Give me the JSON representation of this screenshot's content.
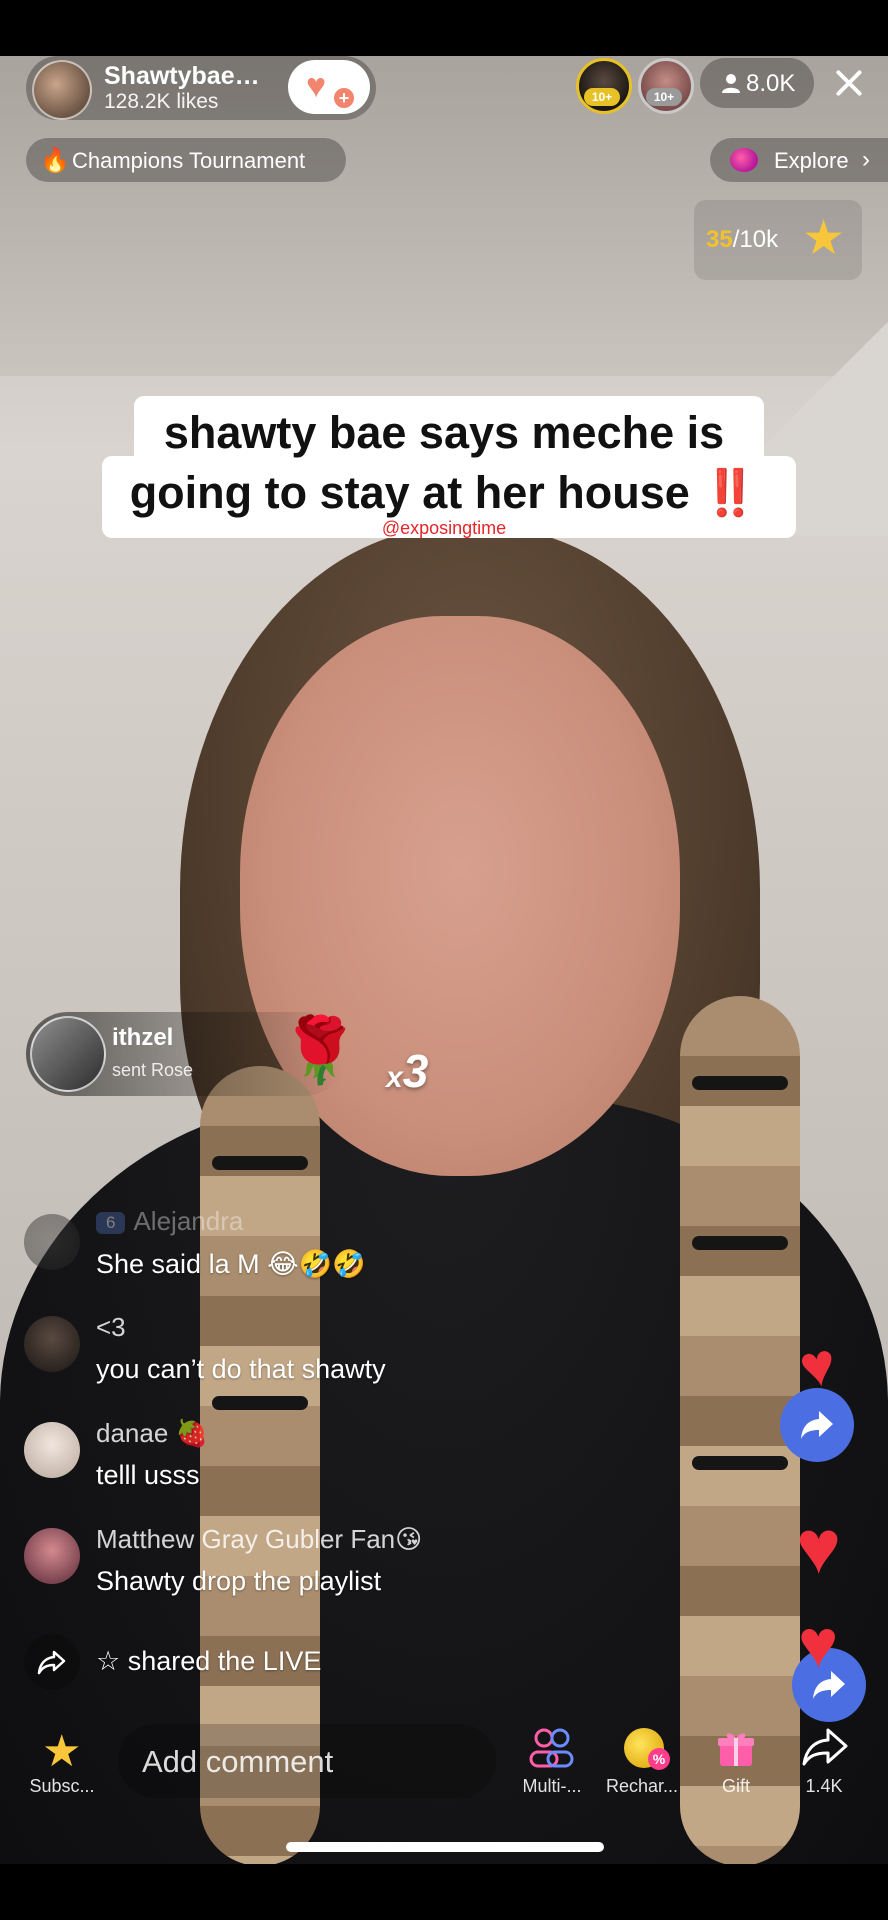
{
  "host": {
    "name": "Shawtybae…",
    "likes": "128.2K likes"
  },
  "viewers": {
    "badge_1": "10+",
    "badge_2": "10+",
    "count": "8.0K"
  },
  "tournament": {
    "label": "Champions Tournament"
  },
  "explore": {
    "label": "Explore",
    "chevron": "›"
  },
  "goal": {
    "current": "35",
    "target": "/10k"
  },
  "caption": {
    "line1": "shawty bae says meche is",
    "line2": "going to stay at her house",
    "emoji": "‼️",
    "watermark": "@exposingtime"
  },
  "gift_toast": {
    "user": "ithzel",
    "action": "sent Rose",
    "count_prefix": "x",
    "count": "3"
  },
  "chat": [
    {
      "name": "Alejandra",
      "level": "6",
      "message": "She said la M 😂🤣🤣"
    },
    {
      "name": "<3",
      "message": "you can’t do that shawty"
    },
    {
      "name": "danae 🍓",
      "message": "telll usss"
    },
    {
      "name": "Matthew Gray Gubler Fan😘",
      "message": "Shawty drop the playlist"
    }
  ],
  "share_event": {
    "text": "☆ shared the LIVE"
  },
  "bottom_bar": {
    "subscribe": "Subsc...",
    "comment_placeholder": "Add comment",
    "multi": "Multi-...",
    "recharge": "Rechar...",
    "gift": "Gift",
    "share_count": "1.4K"
  },
  "colors": {
    "accent_gold": "#f3c12b",
    "heart": "#f0303c",
    "share_blue": "#4b6fe3",
    "gift_pink": "#ff5ea8"
  },
  "icons": [
    "person-icon",
    "close-icon",
    "fire-icon",
    "planet-icon",
    "star-icon",
    "rose-icon",
    "share-icon",
    "heart-icon",
    "multi-guest-icon",
    "coin-icon",
    "gift-icon"
  ]
}
